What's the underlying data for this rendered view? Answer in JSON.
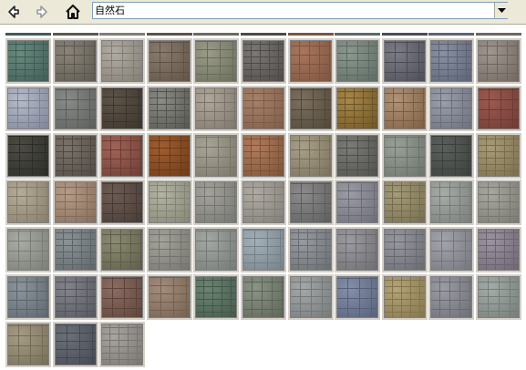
{
  "toolbar": {
    "back_icon": "back-arrow-icon",
    "forward_icon": "forward-arrow-icon",
    "home_icon": "home-icon",
    "address_value": "自然石",
    "dropdown_icon": "chevron-down-icon"
  },
  "gallery": {
    "palettes": [
      [
        "#6a8a7e",
        "#3f5c55"
      ],
      [
        "#8a8478",
        "#5c5850"
      ],
      [
        "#b0aca4",
        "#827c72"
      ],
      [
        "#8a7c6c",
        "#5e5246"
      ],
      [
        "#9a9c88",
        "#6a6c5c"
      ],
      [
        "#7c7874",
        "#4e4a48"
      ],
      [
        "#a8765c",
        "#7c5440"
      ],
      [
        "#8c9890",
        "#5c6a62"
      ],
      [
        "#7c7c84",
        "#4c4c58"
      ],
      [
        "#8a92a2",
        "#5c6274"
      ],
      [
        "#a09690",
        "#706660"
      ],
      [
        "#b8bcc8",
        "#7c8296"
      ],
      [
        "#8a8c8a",
        "#5a5c5a"
      ],
      [
        "#5c5448",
        "#3c342c"
      ],
      [
        "#8c8c88",
        "#54544e"
      ],
      [
        "#b0a89c",
        "#7c746a"
      ],
      [
        "#a88068",
        "#7c5c48"
      ],
      [
        "#7c7060",
        "#4e4638"
      ],
      [
        "#a88848",
        "#6c5428"
      ],
      [
        "#b09478",
        "#7c5c40"
      ],
      [
        "#9ca0aa",
        "#6a6e7c"
      ],
      [
        "#9c5a50",
        "#6c3a34"
      ],
      [
        "#4c4c44",
        "#2c2c28"
      ],
      [
        "#7c746c",
        "#4e4842"
      ],
      [
        "#a06458",
        "#6c3c34"
      ],
      [
        "#a05e30",
        "#6c3a18"
      ],
      [
        "#a8a498",
        "#787466"
      ],
      [
        "#b07c5c",
        "#7c5238"
      ],
      [
        "#a8a088",
        "#78705c"
      ],
      [
        "#7c7c78",
        "#4e4e4a"
      ],
      [
        "#98a098",
        "#6a726a"
      ],
      [
        "#5c605c",
        "#3c403c"
      ],
      [
        "#a89c78",
        "#786c4c"
      ],
      [
        "#b4ac98",
        "#847c68"
      ],
      [
        "#b49c88",
        "#846c5a"
      ],
      [
        "#6c5c54",
        "#463a34"
      ],
      [
        "#b4b4a4",
        "#848474"
      ],
      [
        "#a4a49c",
        "#747470"
      ],
      [
        "#b0aca4",
        "#807c76"
      ],
      [
        "#8c8c8c",
        "#5c5c5c"
      ],
      [
        "#9c9ca4",
        "#6c6c78"
      ],
      [
        "#a49c78",
        "#746c4e"
      ],
      [
        "#a8aca8",
        "#787c78"
      ],
      [
        "#a8a8a0",
        "#787870"
      ],
      [
        "#a8aca4",
        "#787c74"
      ],
      [
        "#8c9498",
        "#5c6468"
      ],
      [
        "#8c8c74",
        "#5c5c48"
      ],
      [
        "#a4a49c",
        "#74746e"
      ],
      [
        "#a4a8a4",
        "#747874"
      ],
      [
        "#a4b0b8",
        "#748088"
      ],
      [
        "#989ca0",
        "#686c70"
      ],
      [
        "#9c9ca0",
        "#6c6c70"
      ],
      [
        "#9898a0",
        "#686870"
      ],
      [
        "#a4a4ac",
        "#74747c"
      ],
      [
        "#9c94a0",
        "#6c6470"
      ],
      [
        "#8c949c",
        "#5c646c"
      ],
      [
        "#84848c",
        "#54545c"
      ],
      [
        "#8c6c60",
        "#5c443c"
      ],
      [
        "#a48c7c",
        "#74604e"
      ],
      [
        "#6c8474",
        "#44584a"
      ],
      [
        "#8c9488",
        "#5c6458"
      ],
      [
        "#a4a8a8",
        "#747878"
      ],
      [
        "#8490a8",
        "#566078"
      ],
      [
        "#b4a478",
        "#84744c"
      ],
      [
        "#9c9ca4",
        "#6c6c74"
      ],
      [
        "#a4aca8",
        "#747c78"
      ],
      [
        "#a49c84",
        "#746c56"
      ],
      [
        "#6c7078",
        "#444850"
      ],
      [
        "#a8a4a0",
        "#787470"
      ]
    ]
  }
}
